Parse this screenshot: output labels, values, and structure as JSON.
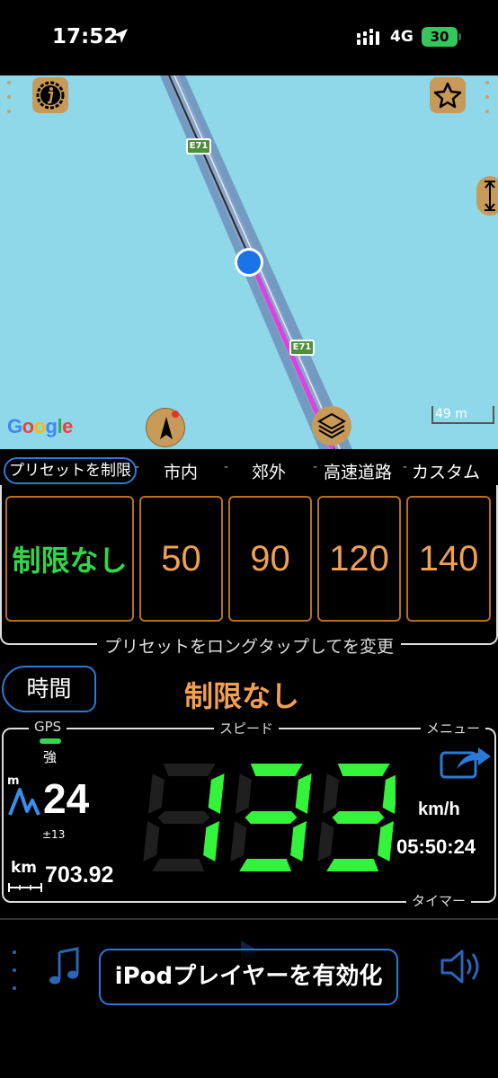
{
  "status_bar": {
    "time": "17:52",
    "network": "4G",
    "battery": "30"
  },
  "map": {
    "provider_logo": "Google",
    "scale": "49 m",
    "route_badges": [
      "E71",
      "E71"
    ],
    "colors": {
      "water": "#8fd8ea",
      "road": "#6f8fb8",
      "route": "#e040e0",
      "location": "#1a73e8"
    }
  },
  "presets": {
    "title": "プリセットを制限",
    "tabs": [
      "市内",
      "郊外",
      "高速道路",
      "カスタム"
    ],
    "separators": [
      "-",
      "-",
      "-",
      "-"
    ],
    "values": [
      "制限なし",
      "50",
      "90",
      "120",
      "140"
    ],
    "hint": "プリセットをロングタップしてを変更"
  },
  "header": {
    "time_button": "時間",
    "current_limit": "制限なし"
  },
  "speedometer": {
    "gps_label": "GPS",
    "gps_strength": "強",
    "speed_label": "スピード",
    "menu_label": "メニュー",
    "altitude_unit": "m",
    "altitude": "24",
    "altitude_accuracy": "±13",
    "distance_unit": "km",
    "distance": "703.92",
    "speed": "133",
    "speed_unit": "km/h",
    "timer": "05:50:24",
    "timer_label": "タイマー",
    "digit_color": "#33f33a"
  },
  "player": {
    "enable_button": "iPodプレイヤーを有効化"
  }
}
